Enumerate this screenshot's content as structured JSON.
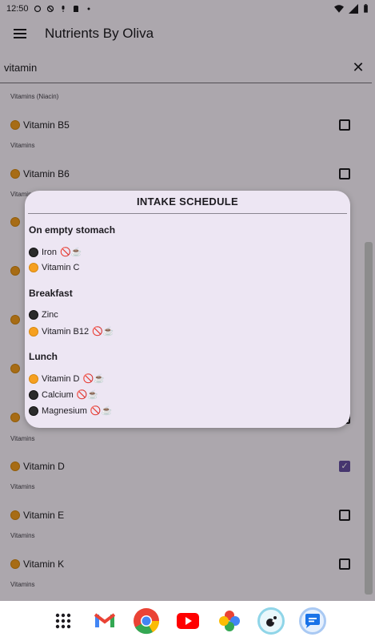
{
  "status_bar": {
    "time": "12:50"
  },
  "app_bar": {
    "title": "Nutrients By Oliva"
  },
  "search": {
    "value": "vitamin",
    "clear_icon": "close-icon"
  },
  "list": {
    "top_sub": "Vitamins (Niacin)",
    "items": [
      {
        "name": "Vitamin B5",
        "category": "Vitamins",
        "dot": "orange",
        "checked": false
      },
      {
        "name": "Vitamin B6",
        "category": "Vitamins",
        "dot": "orange",
        "checked": false
      },
      {
        "name": "",
        "category": "",
        "dot": "orange",
        "checked": false
      },
      {
        "name": "",
        "category": "",
        "dot": "orange",
        "checked": false
      },
      {
        "name": "",
        "category": "",
        "dot": "orange",
        "checked": false
      },
      {
        "name": "",
        "category": "",
        "dot": "orange",
        "checked": false
      },
      {
        "name": "",
        "category": "Vitamins",
        "dot": "orange",
        "checked": false
      },
      {
        "name": "Vitamin D",
        "category": "Vitamins",
        "dot": "orange",
        "checked": true
      },
      {
        "name": "Vitamin E",
        "category": "Vitamins",
        "dot": "orange",
        "checked": false
      },
      {
        "name": "Vitamin K",
        "category": "Vitamins",
        "dot": "orange",
        "checked": false
      }
    ]
  },
  "dialog": {
    "title": "INTAKE SCHEDULE",
    "sections": [
      {
        "heading": "On empty stomach",
        "items": [
          {
            "name": "Iron",
            "dot": "black",
            "badge": "🚫☕"
          },
          {
            "name": "Vitamin C",
            "dot": "orange",
            "badge": ""
          }
        ]
      },
      {
        "heading": "Breakfast",
        "items": [
          {
            "name": "Zinc",
            "dot": "black",
            "badge": ""
          },
          {
            "name": "Vitamin B12",
            "dot": "orange",
            "badge": "🚫☕"
          }
        ]
      },
      {
        "heading": "Lunch",
        "items": [
          {
            "name": "Vitamin D",
            "dot": "orange",
            "badge": "🚫☕"
          },
          {
            "name": "Calcium",
            "dot": "black",
            "badge": "🚫☕"
          },
          {
            "name": "Magnesium",
            "dot": "black",
            "badge": "🚫☕"
          }
        ]
      }
    ]
  },
  "dock": {
    "apps": [
      "app-drawer-icon",
      "gmail-icon",
      "chrome-icon",
      "youtube-icon",
      "photos-icon",
      "assistant-icon",
      "messages-icon"
    ]
  },
  "colors": {
    "accent": "#6750a4",
    "orange_dot": "#f6a020",
    "black_dot": "#2b2b2b"
  }
}
